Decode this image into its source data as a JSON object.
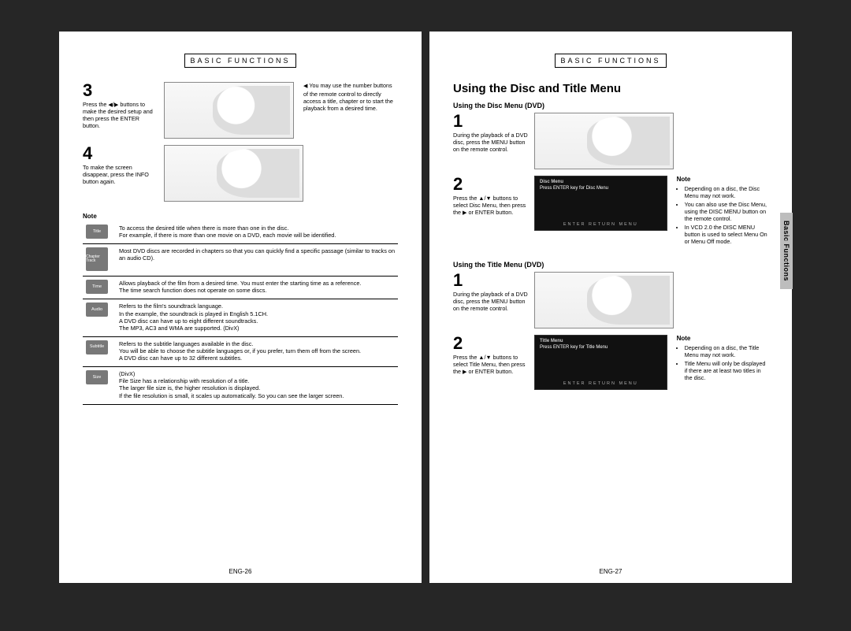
{
  "left": {
    "header": "BASIC FUNCTIONS",
    "step3": {
      "num": "3",
      "desc": "Press the ◀/▶ buttons to make the desired setup and then press the ENTER button.",
      "side": "You may use the number buttons of the remote control to directly access a title, chapter or to start the playback from a desired time."
    },
    "step4": {
      "num": "4",
      "desc": "To make the screen disappear, press the INFO button again."
    },
    "noteLabel": "Note",
    "rows": [
      {
        "icon": "Title",
        "text": "To access the desired title when there is more than one in the disc.\nFor example, if there is more than one movie on a DVD, each movie will be identified."
      },
      {
        "icon": "Chapter Track",
        "text": "Most DVD discs are recorded in chapters so that you can quickly find a specific passage (similar to tracks on an audio CD)."
      },
      {
        "icon": "Time",
        "text": "Allows playback of the film from a desired time. You must enter the starting time as a reference.\nThe time search function does not operate on some discs."
      },
      {
        "icon": "Audio",
        "text": "Refers to the film's soundtrack language.\nIn the example, the soundtrack is played in English 5.1CH.\nA DVD disc can have up to eight different soundtracks.\nThe MP3, AC3 and WMA are supported. (DivX)"
      },
      {
        "icon": "Subtitle",
        "text": "Refers to the subtitle languages available in the disc.\nYou will be able to choose the subtitle languages or, if you prefer, turn them off from the screen.\nA DVD disc can have up to 32 different subtitles."
      },
      {
        "icon": "Size",
        "text": "(DivX)\nFile Size has a relationship with resolution of a title.\nThe larger file size is, the higher resolution is displayed.\nIf the file resolution is small, it scales up automatically. So you can see the larger screen."
      }
    ],
    "pageNum": "ENG-26"
  },
  "right": {
    "header": "BASIC FUNCTIONS",
    "title": "Using the Disc and Title Menu",
    "sideTab": "Basic Functions",
    "discSub": "Using the Disc Menu (DVD)",
    "discStep1": {
      "num": "1",
      "desc": "During the playback of a DVD disc, press the MENU button on the remote control."
    },
    "discStep2": {
      "num": "2",
      "desc": "Press the ▲/▼ buttons to select Disc Menu, then press the ▶ or ENTER button.",
      "osd1": "Disc Menu",
      "osd2": "Press ENTER key for Disc Menu",
      "osdBottom": "ENTER   RETURN   MENU"
    },
    "discNoteLabel": "Note",
    "discNotes": [
      "Depending on a disc, the Disc Menu may not work.",
      "You can also use the Disc Menu, using the DISC MENU button on the remote control.",
      "In VCD 2.0 the DISC MENU button is used to select Menu On or Menu Off mode."
    ],
    "titleSub": "Using the Title Menu (DVD)",
    "titleStep1": {
      "num": "1",
      "desc": "During the playback of a DVD disc, press the MENU button on the remote control."
    },
    "titleStep2": {
      "num": "2",
      "desc": "Press the ▲/▼ buttons to select Title Menu, then press the ▶ or ENTER button.",
      "osd1": "Title Menu",
      "osd2": "Press ENTER key for Title Menu",
      "osdBottom": "ENTER   RETURN   MENU"
    },
    "titleNoteLabel": "Note",
    "titleNotes": [
      "Depending on a disc, the Title Menu may not work.",
      "Title Menu will only be displayed if there are at least two titles in the disc."
    ],
    "pageNum": "ENG-27"
  }
}
